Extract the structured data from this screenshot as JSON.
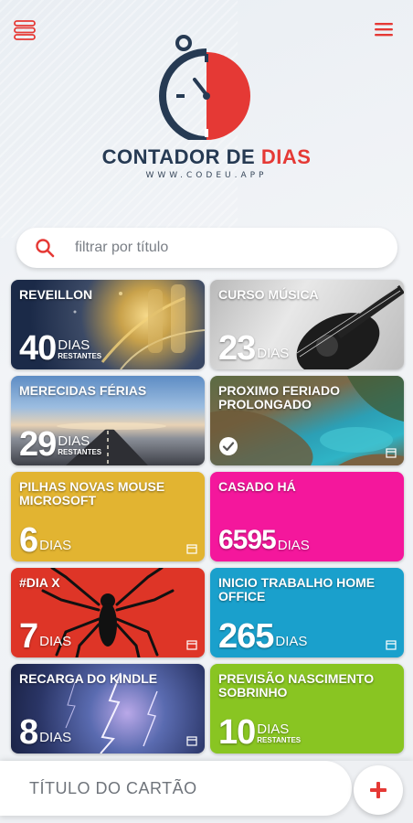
{
  "app": {
    "title_main": "CONTADOR DE ",
    "title_accent": "DIAS",
    "url": "WWW.CODEU.APP"
  },
  "colors": {
    "accent": "#e53935",
    "navy": "#263a53"
  },
  "search": {
    "placeholder": "filtrar por título"
  },
  "cards": [
    {
      "title": "REVEILLON",
      "number": "40",
      "unit": "DIAS",
      "sub": "RESTANTES",
      "bg": "photo-fireworks"
    },
    {
      "title": "CURSO MÚSICA",
      "number": "23",
      "unit": "DIAS",
      "sub": "",
      "bg": "photo-guitar"
    },
    {
      "title": "MERECIDAS FÉRIAS",
      "number": "29",
      "unit": "DIAS",
      "sub": "RESTANTES",
      "bg": "photo-road"
    },
    {
      "title": "PROXIMO FERIADO PROLONGADO",
      "number": "",
      "unit": "",
      "sub": "",
      "bg": "photo-coast",
      "icon": "check-circle-icon"
    },
    {
      "title": "PILHAS NOVAS MOUSE MICROSOFT",
      "number": "6",
      "unit": "DIAS",
      "sub": "",
      "bg": "#e2b431"
    },
    {
      "title": "CASADO HÁ",
      "number": "6595",
      "unit": "DIAS",
      "sub": "",
      "bg": "#f4179c"
    },
    {
      "title": "#DIA X",
      "number": "7",
      "unit": "DIAS",
      "sub": "",
      "bg": "#de3527"
    },
    {
      "title": "INICIO TRABALHO HOME OFFICE",
      "number": "265",
      "unit": "DIAS",
      "sub": "",
      "bg": "#1aa0cc"
    },
    {
      "title": "RECARGA DO KINDLE",
      "number": "8",
      "unit": "DIAS",
      "sub": "",
      "bg": "photo-storm"
    },
    {
      "title": "PREVISÃO NASCIMENTO SOBRINHO",
      "number": "10",
      "unit": "DIAS",
      "sub": "RESTANTES",
      "bg": "#89c522"
    }
  ],
  "new_card": {
    "placeholder": "TÍTULO DO CARTÃO"
  }
}
